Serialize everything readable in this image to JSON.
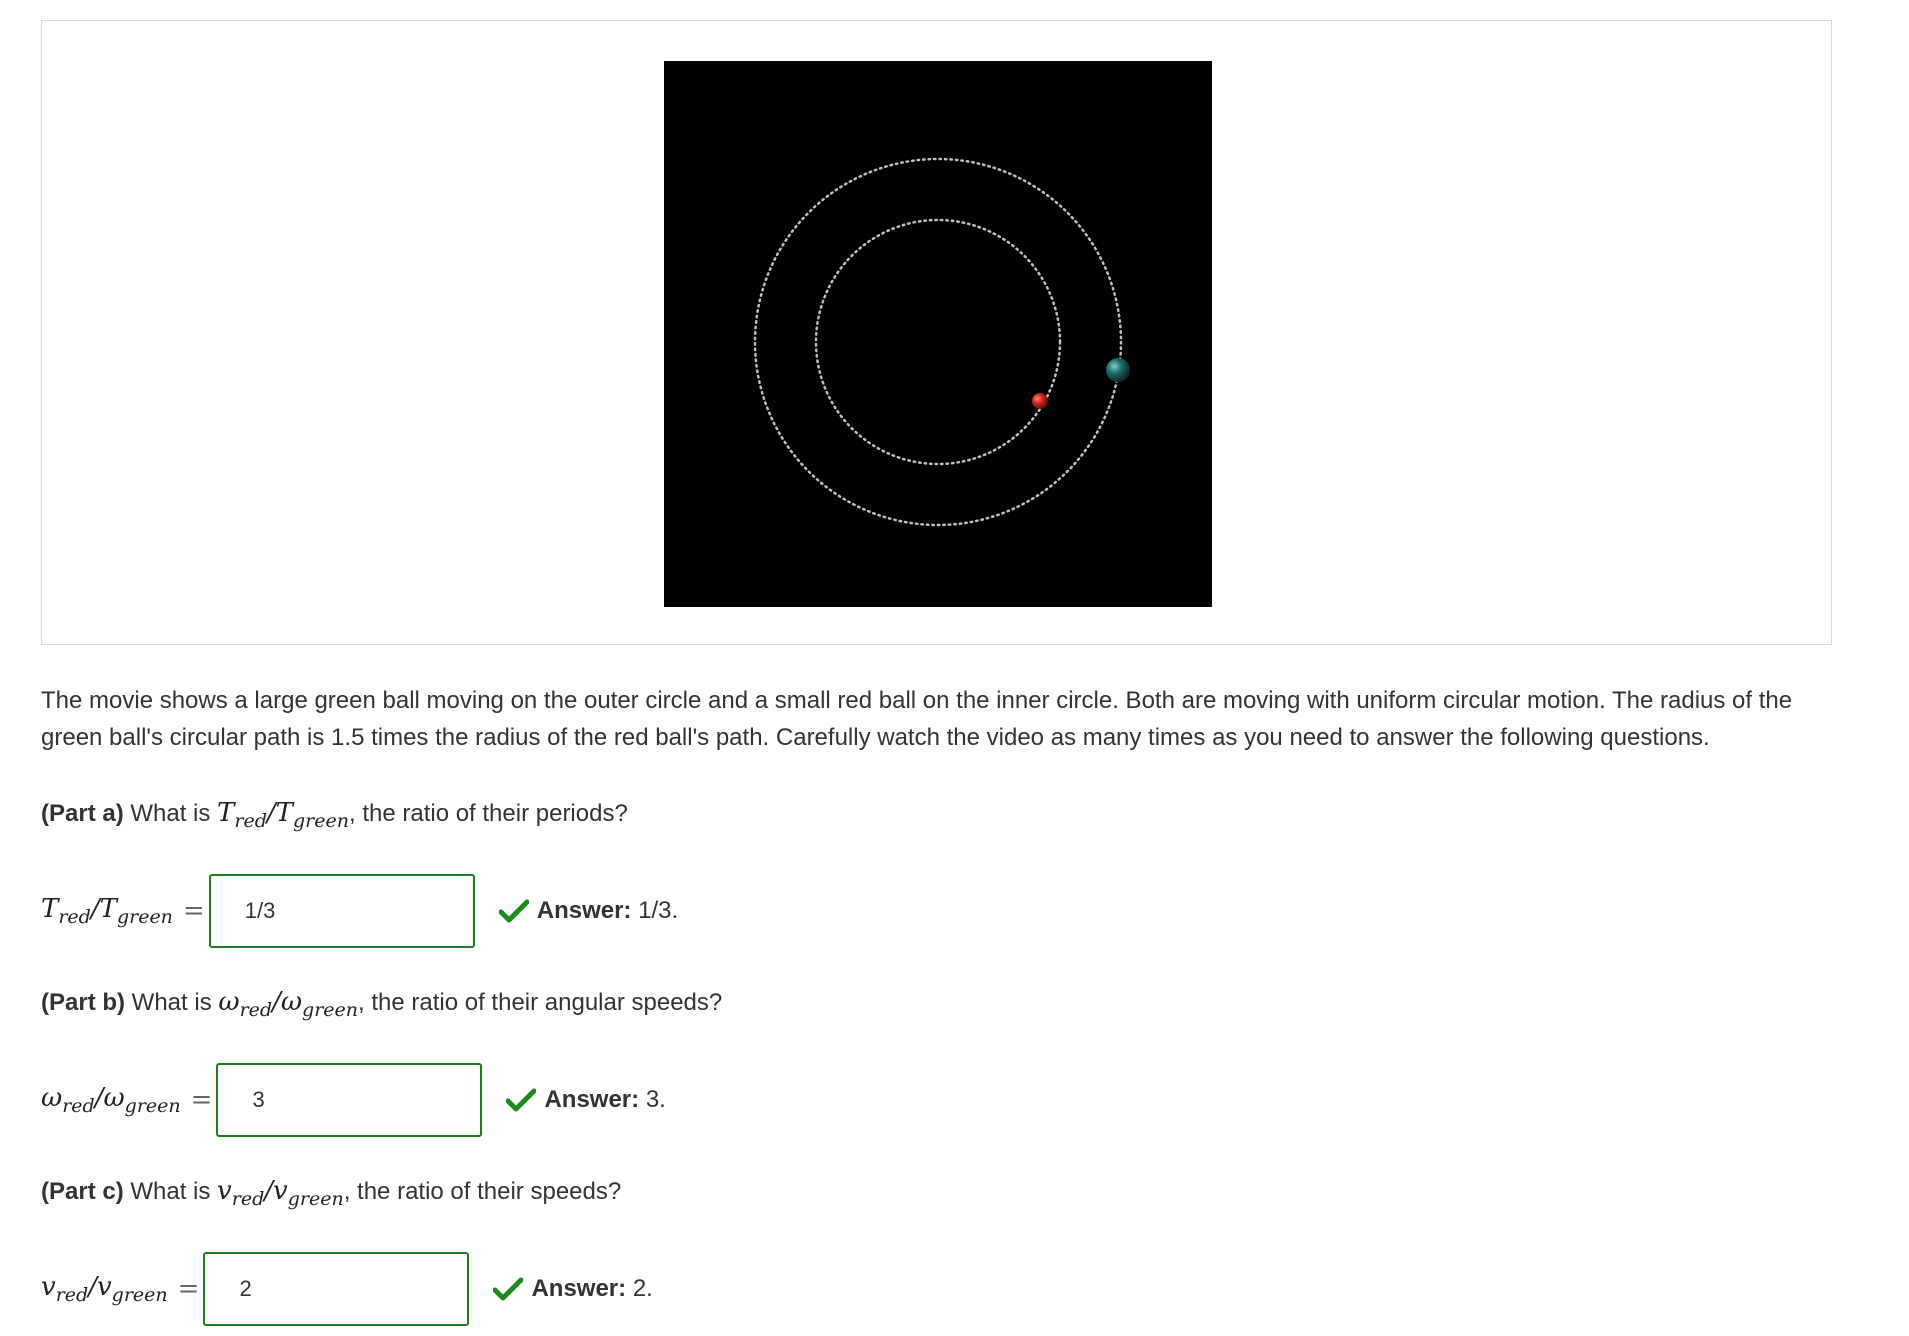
{
  "description": "The movie shows a large green ball moving on the outer circle and a small red ball on the inner circle. Both are moving with uniform circular motion. The radius of the green ball's circular path is 1.5 times the radius of the red ball's path. Carefully watch the video as many times as you need to answer the following questions.",
  "colors": {
    "accent_green": "#1e7e1e",
    "check_green": "#1a8a1a",
    "movie_background": "#000000",
    "red_ball": "#d42b1e",
    "green_ball": "#1f6b6b",
    "orbit_dots": "#bfbfbf"
  },
  "parts": [
    {
      "label": "(Part a)",
      "question_prefix": "What is ",
      "math_symbol": "T",
      "sub_red": "red",
      "sub_green": "green",
      "question_suffix": ", the ratio of their periods?",
      "input_value": "1/3",
      "answer_label": "Answer:",
      "answer_value": "1/3."
    },
    {
      "label": "(Part b)",
      "question_prefix": "What is ",
      "math_symbol": "ω",
      "sub_red": "red",
      "sub_green": "green",
      "question_suffix": ", the ratio of their angular speeds?",
      "input_value": "3",
      "answer_label": "Answer:",
      "answer_value": "3."
    },
    {
      "label": "(Part c)",
      "question_prefix": "What is ",
      "math_symbol": "v",
      "sub_red": "red",
      "sub_green": "green",
      "question_suffix": ", the ratio of their speeds?",
      "input_value": "2",
      "answer_label": "Answer:",
      "answer_value": "2."
    }
  ],
  "icons": {
    "feedback": "check-icon"
  }
}
